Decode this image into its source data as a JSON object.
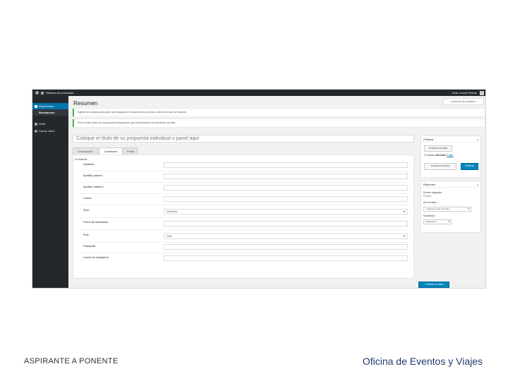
{
  "admin_bar": {
    "site_name": "Sistema de ponencias",
    "user_greeting": "Hola, emma Pedraz"
  },
  "sidebar": {
    "items": [
      {
        "label": "Resúmenes",
        "icon": "pin-icon"
      },
      {
        "label": "Resúmenes"
      },
      {
        "label": "Perfil",
        "icon": "user-icon"
      },
      {
        "label": "Cerrar menú",
        "icon": "collapse-icon"
      }
    ]
  },
  "screen_options": "Opciones de pantalla ▾",
  "page_title": "Resumen",
  "notices": [
    "Ingrese los campos para quien sera asignado el resumen de ponencia, antes de enviar su resumen",
    "Favor revise todos los campos para asegurarse que la informacion se encuentre correcta"
  ],
  "title_placeholder": "Coloque el título de su propuesta individual o panel aquí",
  "tabs": [
    "Descripción",
    "Coautores",
    "Panel"
  ],
  "coauthors": {
    "section_title": "Co-autores",
    "fields": [
      {
        "label": "Nombres",
        "type": "input",
        "value": ""
      },
      {
        "label": "Apellido paterno",
        "type": "input",
        "value": ""
      },
      {
        "label": "Apellido materno",
        "type": "input",
        "value": ""
      },
      {
        "label": "Correo",
        "type": "input",
        "value": ""
      },
      {
        "label": "Sexo",
        "type": "select",
        "value": "Masculino"
      },
      {
        "label": "Fecha de nacimiento",
        "type": "input",
        "value": ""
      },
      {
        "label": "País",
        "type": "select",
        "value": "Chile"
      },
      {
        "label": "Pasaporte",
        "type": "input",
        "value": ""
      },
      {
        "label": "Carnet de extranjería",
        "type": "input",
        "value": ""
      }
    ],
    "add_button": "+ Añadir co-autor"
  },
  "publish_box": {
    "title": "Publicar",
    "save_draft": "Guardar borrador",
    "status_label": "Estado:",
    "status_value": "Borrador",
    "status_edit": "Editar",
    "preview_button": "Guardar borrador",
    "publish_button": "Publicar"
  },
  "resumen_box": {
    "title": "Resumen",
    "event_label": "Evento asignado:",
    "event_value": "Prueba",
    "thematic_label": "Eje temático",
    "thematic_value": "- Seleccione Eje Temático -",
    "modality_label": "Modalidad",
    "modality_value": "Modalidad 1"
  },
  "footer": {
    "left_caption": "ASPIRANTE A PONENTE",
    "right_caption": "Oficina de Eventos y Viajes"
  }
}
